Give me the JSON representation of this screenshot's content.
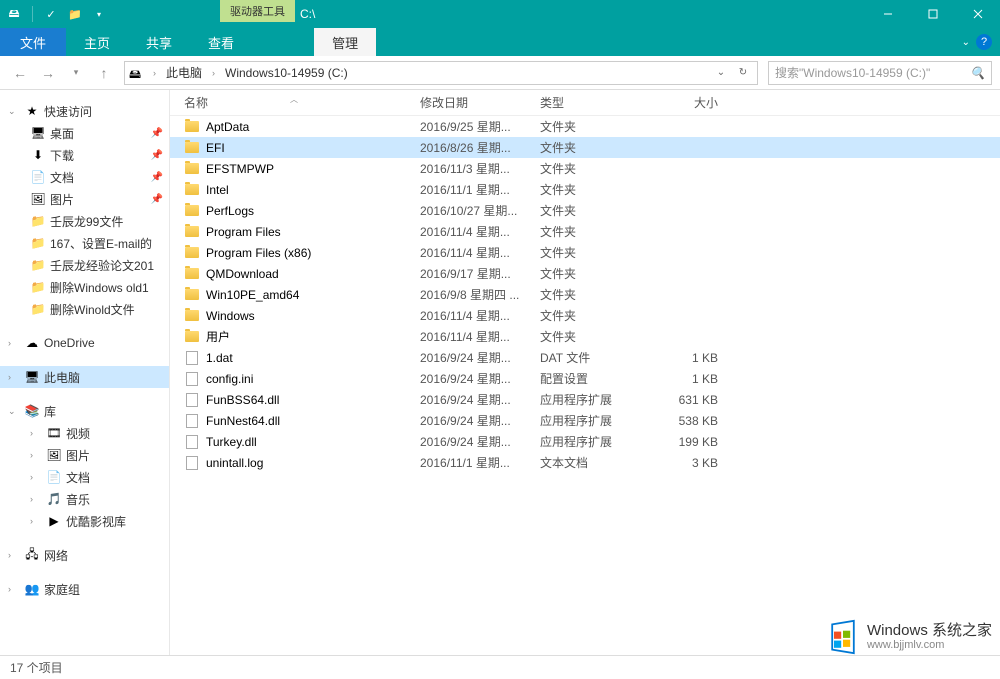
{
  "titlebar": {
    "tool_tab": "驱动器工具",
    "title": "C:\\"
  },
  "ribbon": {
    "file": "文件",
    "tabs": [
      "主页",
      "共享",
      "查看"
    ],
    "contextual": "管理"
  },
  "nav": {
    "crumbs": [
      "此电脑",
      "Windows10-14959 (C:)"
    ],
    "search_placeholder": "搜索\"Windows10-14959 (C:)\""
  },
  "sidebar": {
    "quick_access": "快速访问",
    "quick_items": [
      {
        "label": "桌面",
        "pinned": true,
        "icon": "🖥"
      },
      {
        "label": "下载",
        "pinned": true,
        "icon": "⬇"
      },
      {
        "label": "文档",
        "pinned": true,
        "icon": "📄"
      },
      {
        "label": "图片",
        "pinned": true,
        "icon": "🖼"
      },
      {
        "label": "壬辰龙99文件",
        "pinned": false,
        "icon": "📁"
      },
      {
        "label": "167、设置E-mail的",
        "pinned": false,
        "icon": "📁"
      },
      {
        "label": "壬辰龙经验论文201",
        "pinned": false,
        "icon": "📁"
      },
      {
        "label": "删除Windows old1",
        "pinned": false,
        "icon": "📁"
      },
      {
        "label": "删除Winold文件",
        "pinned": false,
        "icon": "📁"
      }
    ],
    "onedrive": "OneDrive",
    "this_pc": "此电脑",
    "libraries": "库",
    "lib_items": [
      {
        "label": "视频",
        "icon": "🎞"
      },
      {
        "label": "图片",
        "icon": "🖼"
      },
      {
        "label": "文档",
        "icon": "📄"
      },
      {
        "label": "音乐",
        "icon": "🎵"
      },
      {
        "label": "优酷影视库",
        "icon": "▶"
      }
    ],
    "network": "网络",
    "homegroup": "家庭组"
  },
  "columns": {
    "name": "名称",
    "date": "修改日期",
    "type": "类型",
    "size": "大小"
  },
  "files": [
    {
      "name": "AptData",
      "date": "2016/9/25 星期...",
      "type": "文件夹",
      "size": "",
      "kind": "folder"
    },
    {
      "name": "EFI",
      "date": "2016/8/26 星期...",
      "type": "文件夹",
      "size": "",
      "kind": "folder",
      "selected": true
    },
    {
      "name": "EFSTMPWP",
      "date": "2016/11/3 星期...",
      "type": "文件夹",
      "size": "",
      "kind": "folder"
    },
    {
      "name": "Intel",
      "date": "2016/11/1 星期...",
      "type": "文件夹",
      "size": "",
      "kind": "folder"
    },
    {
      "name": "PerfLogs",
      "date": "2016/10/27 星期...",
      "type": "文件夹",
      "size": "",
      "kind": "folder"
    },
    {
      "name": "Program Files",
      "date": "2016/11/4 星期...",
      "type": "文件夹",
      "size": "",
      "kind": "folder"
    },
    {
      "name": "Program Files (x86)",
      "date": "2016/11/4 星期...",
      "type": "文件夹",
      "size": "",
      "kind": "folder"
    },
    {
      "name": "QMDownload",
      "date": "2016/9/17 星期...",
      "type": "文件夹",
      "size": "",
      "kind": "folder"
    },
    {
      "name": "Win10PE_amd64",
      "date": "2016/9/8 星期四 ...",
      "type": "文件夹",
      "size": "",
      "kind": "folder"
    },
    {
      "name": "Windows",
      "date": "2016/11/4 星期...",
      "type": "文件夹",
      "size": "",
      "kind": "folder"
    },
    {
      "name": "用户",
      "date": "2016/11/4 星期...",
      "type": "文件夹",
      "size": "",
      "kind": "folder"
    },
    {
      "name": "1.dat",
      "date": "2016/9/24 星期...",
      "type": "DAT 文件",
      "size": "1 KB",
      "kind": "file"
    },
    {
      "name": "config.ini",
      "date": "2016/9/24 星期...",
      "type": "配置设置",
      "size": "1 KB",
      "kind": "file"
    },
    {
      "name": "FunBSS64.dll",
      "date": "2016/9/24 星期...",
      "type": "应用程序扩展",
      "size": "631 KB",
      "kind": "file"
    },
    {
      "name": "FunNest64.dll",
      "date": "2016/9/24 星期...",
      "type": "应用程序扩展",
      "size": "538 KB",
      "kind": "file"
    },
    {
      "name": "Turkey.dll",
      "date": "2016/9/24 星期...",
      "type": "应用程序扩展",
      "size": "199 KB",
      "kind": "file"
    },
    {
      "name": "unintall.log",
      "date": "2016/11/1 星期...",
      "type": "文本文档",
      "size": "3 KB",
      "kind": "file"
    }
  ],
  "statusbar": {
    "count": "17 个项目"
  },
  "watermark": {
    "title": "Windows 系统之家",
    "url": "www.bjjmlv.com"
  }
}
